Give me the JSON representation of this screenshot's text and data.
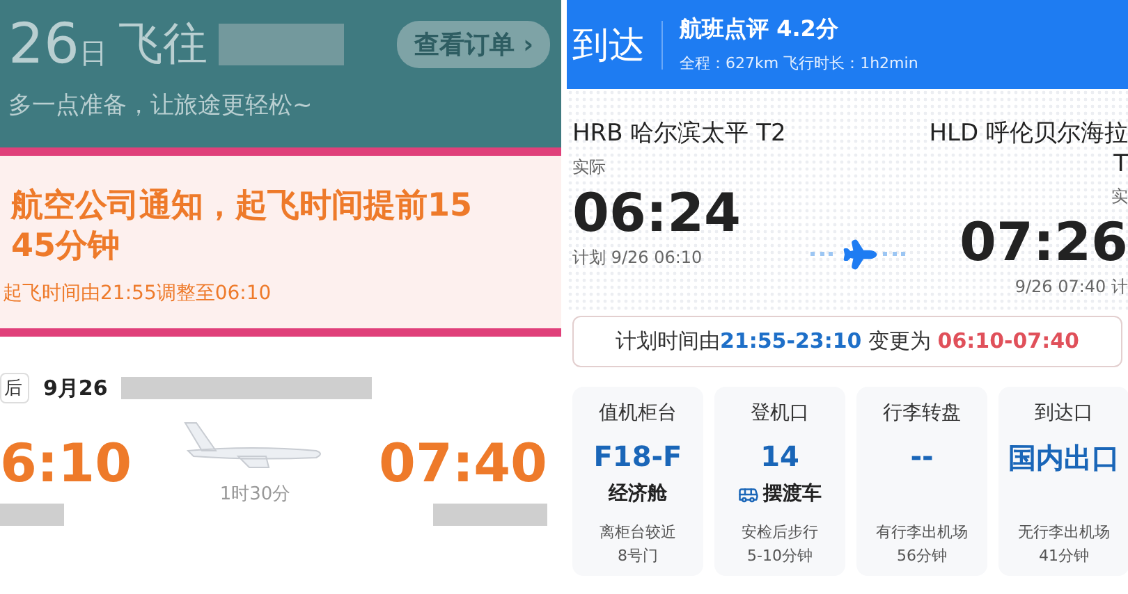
{
  "left_panel": {
    "header": {
      "day": "26",
      "day_unit": "日",
      "destination_label": "飞往",
      "order_button": "查看订单 ›",
      "subtitle": "多一点准备，让旅途更轻松~"
    },
    "notice": {
      "title_lines": [
        "航空公司通知，起飞时间提前15",
        "45分钟"
      ],
      "detail": "起飞时间由21:55调整至06:10"
    },
    "flight": {
      "tag": "后",
      "date": "9月26",
      "departure_time": "6:10",
      "arrival_time": "07:40",
      "duration": "1时30分"
    }
  },
  "right_panel": {
    "header": {
      "title": "到达",
      "rating": "航班点评 4.2分",
      "summary": "全程：627km 飞行时长：1h2min"
    },
    "departure": {
      "airport": "HRB 哈尔滨太平 T2",
      "status": "实际",
      "time": "06:24",
      "planned": "计划 9/26 06:10"
    },
    "arrival": {
      "airport": "HLD 呼伦贝尔海拉",
      "terminal": "T",
      "status": "实",
      "time": "07:26",
      "planned": "9/26 07:40 计"
    },
    "change_notice": {
      "prefix": "计划时间由",
      "old_time": "21:55-23:10",
      "middle": " 变更为 ",
      "new_time": "06:10-07:40"
    },
    "cards": [
      {
        "title": "值机柜台",
        "value": "F18-F",
        "note": "经济舱",
        "lines": [
          "离柜台较近",
          "8号门"
        ]
      },
      {
        "title": "登机口",
        "value": "14",
        "kind": "bus",
        "note": "摆渡车",
        "lines": [
          "安检后步行",
          "5-10分钟"
        ]
      },
      {
        "title": "行李转盘",
        "value": "--",
        "lines": [
          "有行李出机场",
          "56分钟"
        ]
      },
      {
        "title": "到达口",
        "value": "国内出口",
        "lines": [
          "无行李出机场",
          "41分钟"
        ]
      }
    ]
  }
}
